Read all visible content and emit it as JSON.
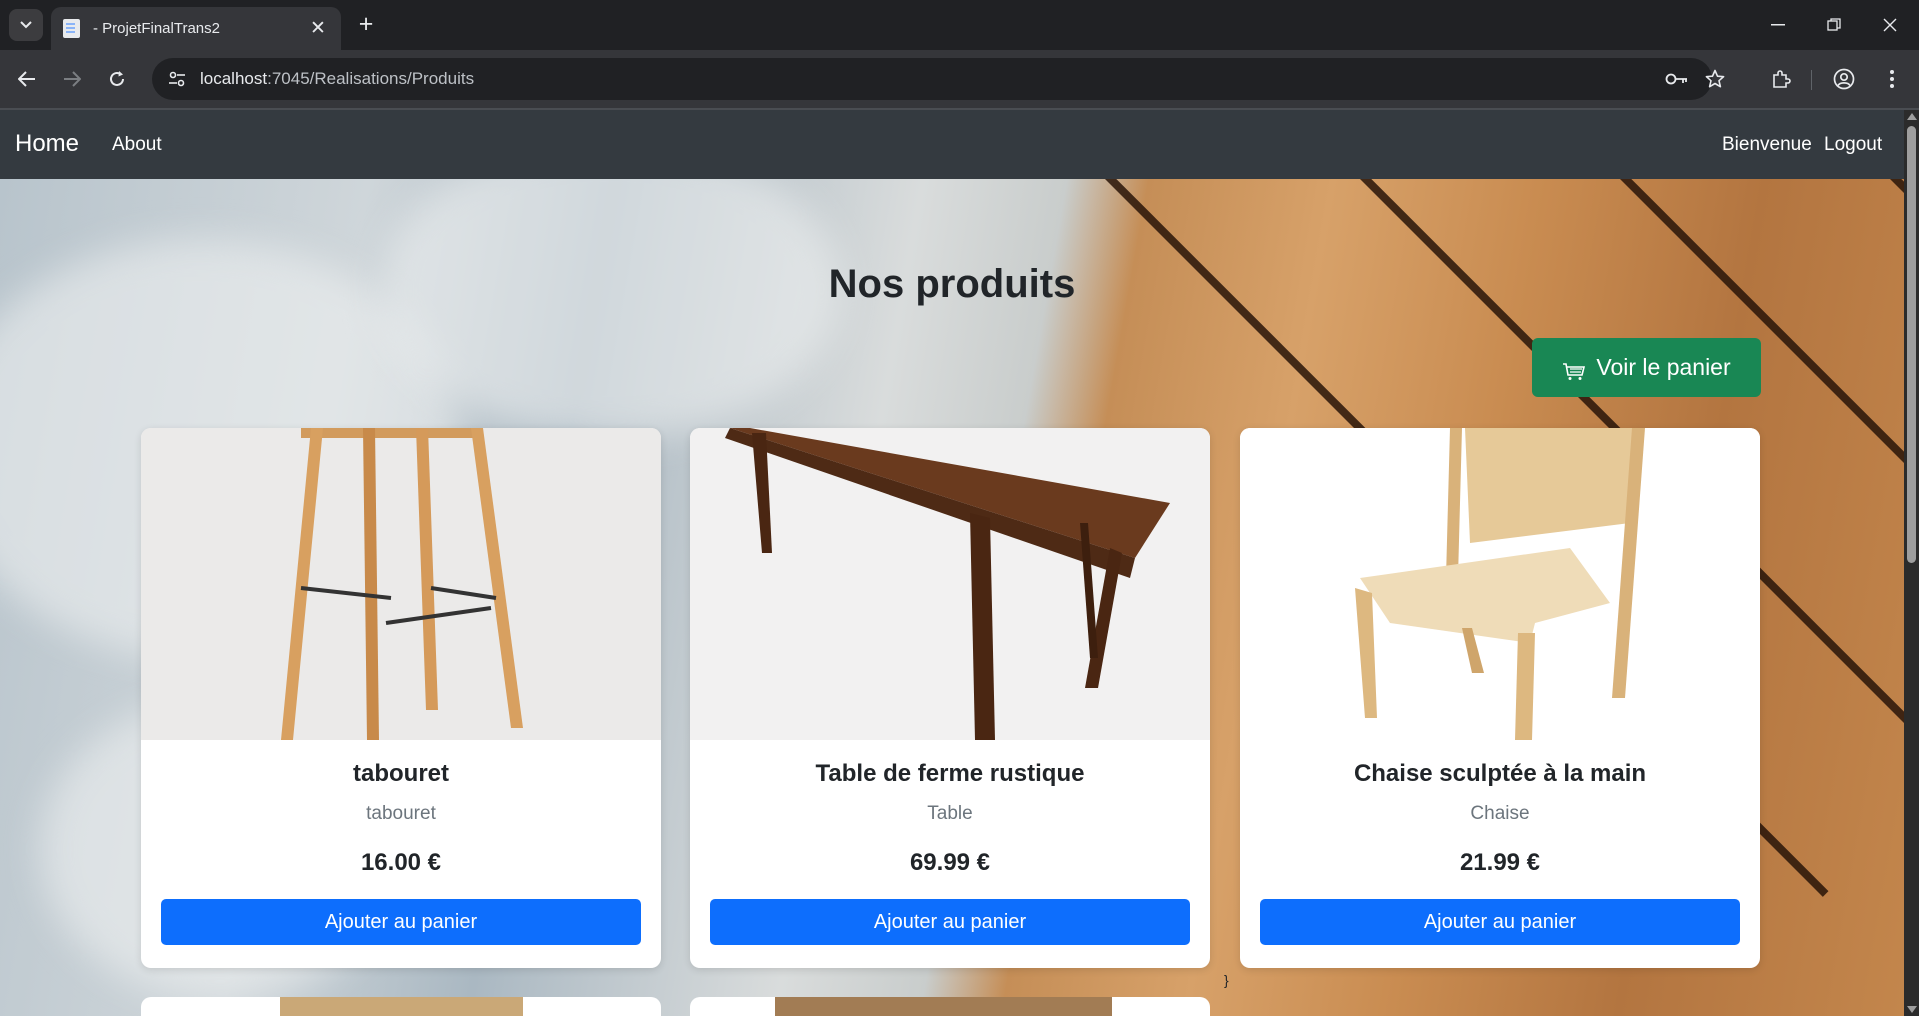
{
  "browser": {
    "tab_title": "- ProjetFinalTrans2",
    "tab_close_glyph": "✕",
    "new_tab_glyph": "+",
    "url_host": "localhost",
    "url_path": ":7045/Realisations/Produits",
    "icons": [
      "tab-search-icon",
      "favicon-icon",
      "minimize-icon",
      "restore-icon",
      "close-window-icon",
      "back-icon",
      "forward-icon",
      "reload-icon",
      "site-info-icon",
      "password-key-icon",
      "bookmark-star-icon",
      "extensions-icon",
      "profile-icon",
      "menu-icon"
    ]
  },
  "navbar": {
    "brand": "Home",
    "links": [
      "About"
    ],
    "right_links": [
      "Bienvenue",
      "Logout"
    ]
  },
  "main": {
    "title": "Nos produits",
    "cart_button": "Voir le panier",
    "stray_text": "}"
  },
  "products": [
    {
      "name": "tabouret",
      "category": "tabouret",
      "price": "16.00 €",
      "button": "Ajouter au panier"
    },
    {
      "name": "Table de ferme rustique",
      "category": "Table",
      "price": "69.99 €",
      "button": "Ajouter au panier"
    },
    {
      "name": "Chaise sculptée à la main",
      "category": "Chaise",
      "price": "21.99 €",
      "button": "Ajouter au panier"
    }
  ],
  "colors": {
    "navbar_bg": "#343a40",
    "cart_button": "#198754",
    "primary_button": "#0d6efd",
    "browser_frame": "#202124",
    "browser_toolbar": "#35363a"
  }
}
